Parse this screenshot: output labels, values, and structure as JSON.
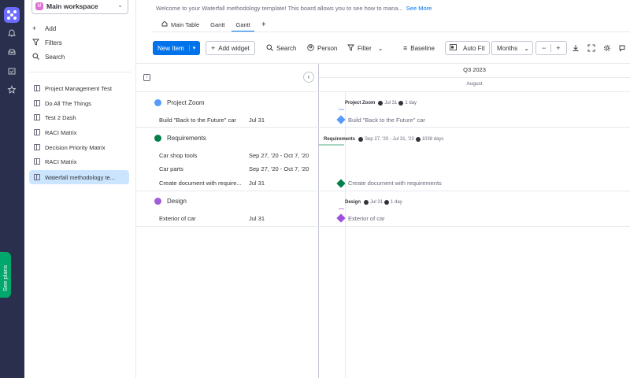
{
  "colors": {
    "rail_bg": "#292f4c",
    "accent": "#0073ea",
    "group_project_zoom": "#579bfc",
    "group_requirements": "#037f4c",
    "group_design": "#a25ddc",
    "milestone_design": "#9d50dd"
  },
  "rail": {
    "icons": [
      "apps-icon",
      "bell-icon",
      "inbox-icon",
      "my-work-icon",
      "favorites-icon"
    ],
    "see_plans": "See plans"
  },
  "sidebar": {
    "workspace": "Main workspace",
    "workspace_badge": "M",
    "actions": [
      {
        "label": "Add",
        "icon": "plus-icon"
      },
      {
        "label": "Filters",
        "icon": "filter-icon"
      },
      {
        "label": "Search",
        "icon": "search-icon"
      }
    ],
    "boards": [
      "Project Management Test",
      "Do All The Things",
      "Test 2 Dash",
      "RACI Matrix",
      "Decision Priority Matrix",
      "RACI Matrix",
      "Waterfall methodology te..."
    ]
  },
  "header": {
    "description": "Welcome to your Waterfall methodology template! This board allows you to see how to mana...",
    "see_more": "See More",
    "tabs": [
      "Main Table",
      "Gantt",
      "Gantt"
    ],
    "add_tab": "+"
  },
  "toolbar": {
    "new_item": "New Item",
    "add_widget": "Add widget",
    "search": "Search",
    "person": "Person",
    "filter": "Filter",
    "baseline": "Baseline",
    "auto_fit": "Auto Fit",
    "months": "Months",
    "zoom_out": "−",
    "zoom_in": "+"
  },
  "gantt": {
    "quarter": "Q3 2023",
    "month": "August",
    "groups": [
      {
        "name": "Project Zoom",
        "summary_meta_1": "Jul 31",
        "summary_meta_2": "1 day",
        "items": [
          {
            "name": "Build \"Back to the Future\" car",
            "date": "Jul 31"
          }
        ]
      },
      {
        "name": "Requirements",
        "summary_meta_1": "Sep 27, '20 - Jul 31, '23",
        "summary_meta_2": "1038 days",
        "items": [
          {
            "name": "Car shop tools",
            "date": "Sep 27, '20 - Oct 7, '20"
          },
          {
            "name": "Car parts",
            "date": "Sep 27, '20 - Oct 7, '20"
          },
          {
            "name": "Create document with require...",
            "date": "Jul 31"
          }
        ],
        "milestone": "Create document with requirements"
      },
      {
        "name": "Design",
        "summary_meta_1": "Jul 31",
        "summary_meta_2": "1 day",
        "items": [
          {
            "name": "Exterior of car",
            "date": "Jul 31"
          }
        ]
      }
    ]
  }
}
